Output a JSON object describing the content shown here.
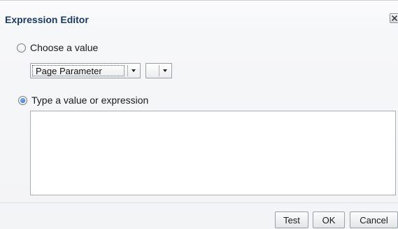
{
  "dialog": {
    "title": "Expression Editor"
  },
  "options": {
    "choose_label": "Choose a value",
    "type_label": "Type a value or expression",
    "selected": "type"
  },
  "choose_value": {
    "source_select": "Page Parameter",
    "value_select": ""
  },
  "expression": {
    "value": ""
  },
  "buttons": {
    "test": "Test",
    "ok": "OK",
    "cancel": "Cancel"
  },
  "icons": {
    "close": "close-icon",
    "dropdown": "chevron-down-icon"
  }
}
